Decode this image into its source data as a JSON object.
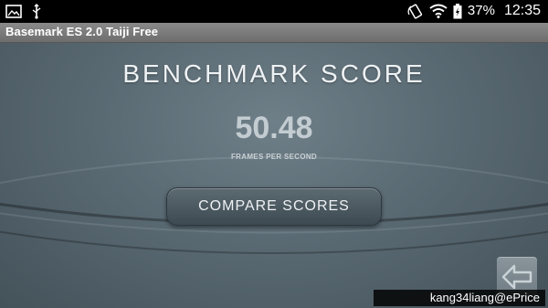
{
  "status_bar": {
    "icons": [
      "image-icon",
      "usb-icon",
      "rotation-icon",
      "wifi-icon",
      "battery-icon"
    ],
    "battery_percent": "37%",
    "time": "12:35"
  },
  "app": {
    "title": "Basemark ES 2.0 Taiji Free"
  },
  "main": {
    "heading": "BENCHMARK SCORE",
    "score": "50.48",
    "score_unit": "FRAMES PER SECOND",
    "compare_button_label": "COMPARE SCORES",
    "back_icon": "back-arrow-icon"
  },
  "watermark": "kang34liang@ePrice",
  "colors": {
    "background": "#5a6a73",
    "title_bar": "#7a7a7a",
    "heading_text": "#eef2f4",
    "score_text": "#c3ccd1"
  }
}
